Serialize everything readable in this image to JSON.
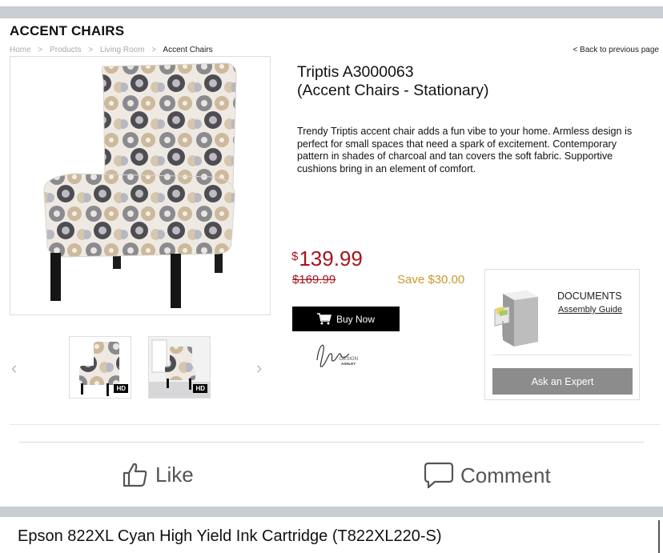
{
  "page": {
    "heading": "ACCENT CHAIRS",
    "back_link": "< Back to previous page"
  },
  "breadcrumb": [
    "Home",
    "Products",
    "Living Room",
    "Accent Chairs"
  ],
  "breadcrumb_separator": ">",
  "product": {
    "title_line1": "Triptis A3000063",
    "title_line2": "(Accent Chairs - Stationary)",
    "description": "Trendy Triptis accent chair adds a fun vibe to your home. Armless design is perfect for small spaces that need a spark of excitement. Contemporary pattern in shades of charcoal and tan covers the soft fabric. Supportive cushions bring in an element of comfort.",
    "price_currency": "$",
    "price_amount": "139.99",
    "old_price": "$169.99",
    "savings": "Save $30.00",
    "buy_label": "Buy Now",
    "brand_mark": "Signature DESIGN ASHLEY"
  },
  "thumbnails": [
    {
      "badge": "HD"
    },
    {
      "badge": "HD"
    }
  ],
  "documents": {
    "title": "DOCUMENTS",
    "link": "Assembly Guide",
    "ask_label": "Ask an Expert"
  },
  "social": {
    "like_label": "Like",
    "comment_label": "Comment"
  },
  "next_post_title": "Epson 822XL Cyan High Yield Ink Cartridge (T822XL220-S)",
  "colors": {
    "price_red": "#a5141e",
    "save_gold": "#c89a2b",
    "band_gray": "#c9ccd1",
    "expert_gray": "#8c8c8c"
  },
  "icons": [
    "cart-icon",
    "file-cabinet-icon",
    "chevron-left-icon",
    "chevron-right-icon",
    "thumbs-up-icon",
    "comment-icon"
  ]
}
